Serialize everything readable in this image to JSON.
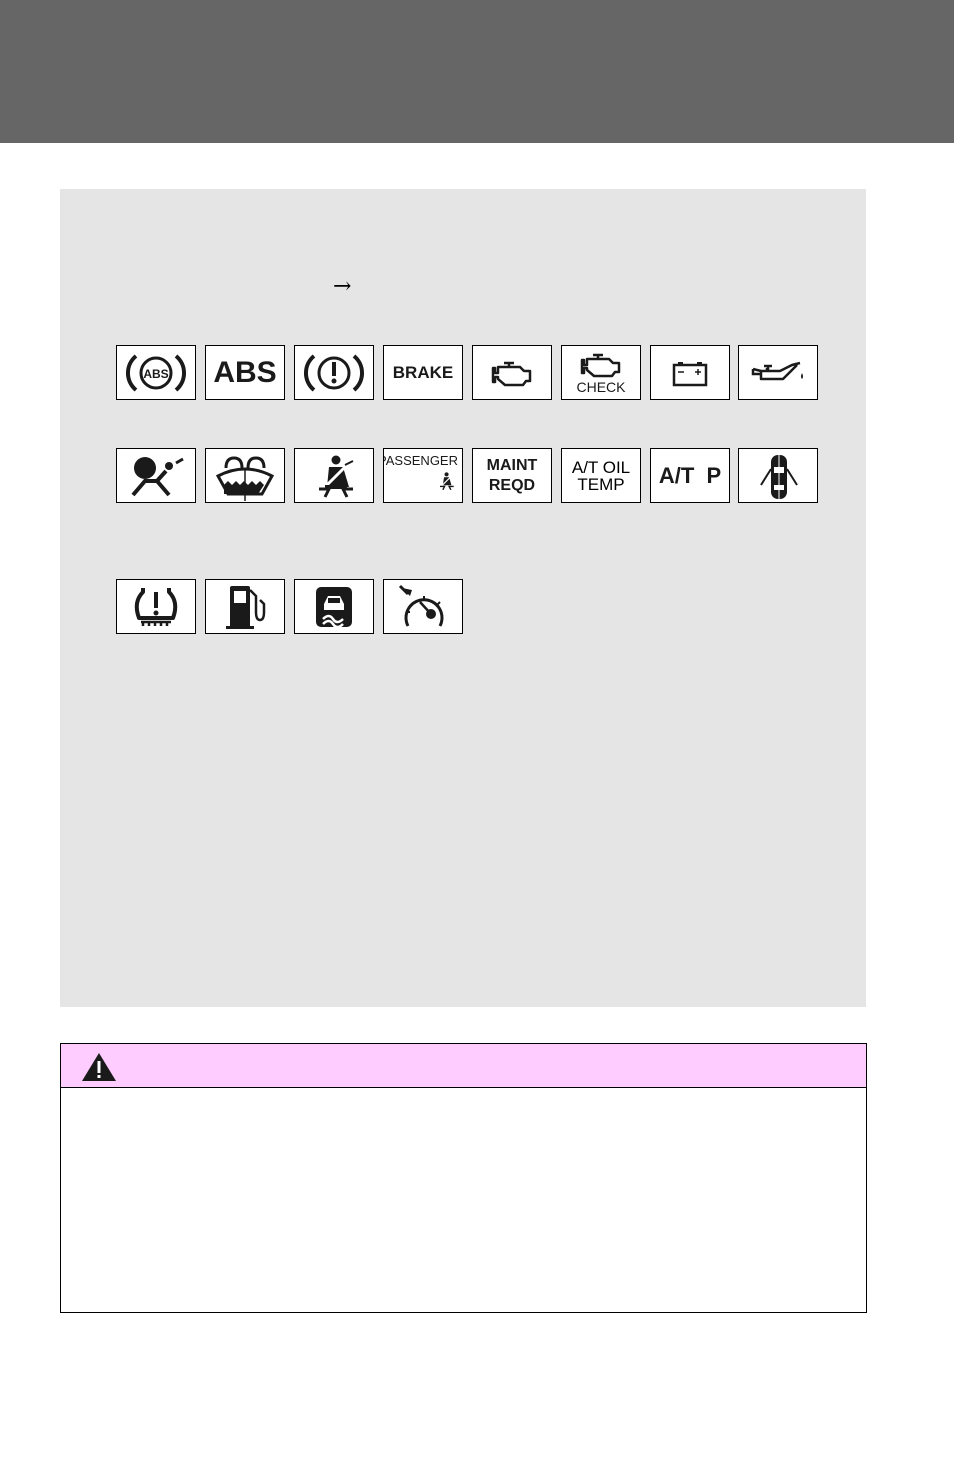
{
  "page": {
    "colors": {
      "header_band": "#666666",
      "panel": "#e5e5e5",
      "caution_header": "#ffccff"
    }
  },
  "panel": {
    "arrow": "→",
    "rows": [
      {
        "icons": [
          {
            "name": "abs-circle-icon",
            "label": "ABS"
          },
          {
            "name": "abs-text-icon",
            "label": "ABS"
          },
          {
            "name": "brake-exclamation-icon",
            "label": "!"
          },
          {
            "name": "brake-text-icon",
            "label": "BRAKE"
          },
          {
            "name": "check-engine-icon",
            "label": ""
          },
          {
            "name": "check-engine-text-icon",
            "label": "CHECK"
          },
          {
            "name": "battery-icon",
            "label": "− +"
          },
          {
            "name": "oil-pressure-icon",
            "label": ""
          }
        ]
      },
      {
        "icons": [
          {
            "name": "airbag-icon",
            "label": ""
          },
          {
            "name": "washer-fluid-icon",
            "label": ""
          },
          {
            "name": "seatbelt-icon",
            "label": ""
          },
          {
            "name": "passenger-seatbelt-icon",
            "label": "PASSENGER"
          },
          {
            "name": "maint-reqd-icon",
            "label1": "MAINT",
            "label2": "REQD"
          },
          {
            "name": "at-oil-temp-icon",
            "label1": "A/T OIL",
            "label2": "TEMP"
          },
          {
            "name": "at-p-icon",
            "label": "A/T  P"
          },
          {
            "name": "door-open-icon",
            "label": ""
          }
        ]
      },
      {
        "icons": [
          {
            "name": "tire-pressure-icon",
            "label": "!"
          },
          {
            "name": "low-fuel-icon",
            "label": ""
          },
          {
            "name": "slip-indicator-icon",
            "label": ""
          },
          {
            "name": "cruise-control-icon",
            "label": ""
          }
        ]
      }
    ]
  },
  "caution": {
    "icon": "warning-triangle-icon"
  }
}
